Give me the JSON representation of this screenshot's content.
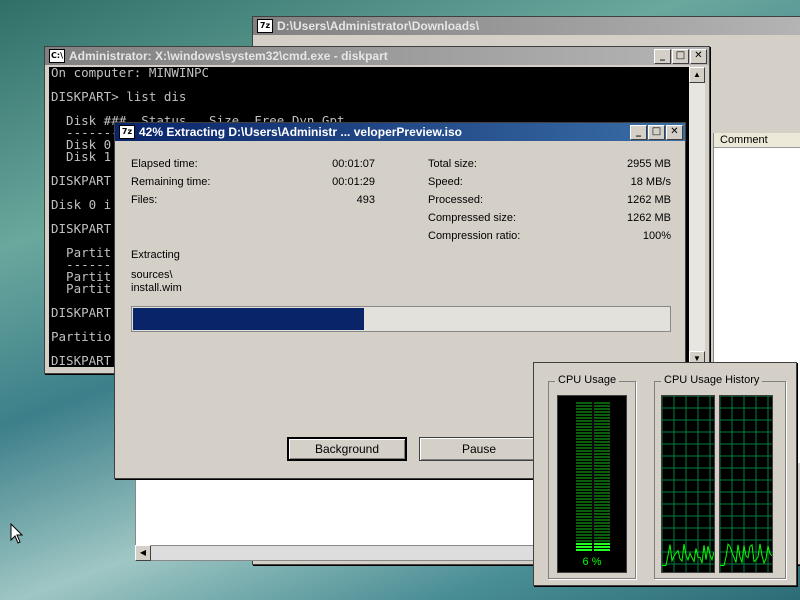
{
  "explorer": {
    "title": "D:\\Users\\Administrator\\Downloads\\",
    "comment_header": "Comment"
  },
  "cmd": {
    "title": "Administrator: X:\\windows\\system32\\cmd.exe - diskpart",
    "lines": [
      "On computer: MINWINPC",
      "",
      "DISKPART> list dis",
      "",
      "  Disk ###  Status   Size  Free Dyn Gpt",
      "  --------",
      "  Disk 0",
      "  Disk 1",
      "",
      "DISKPART",
      "",
      "Disk 0 i",
      "",
      "DISKPART",
      "",
      "  Partit",
      "  ------",
      "  Partit",
      "  Partit",
      "",
      "DISKPART",
      "",
      "Partitio",
      "",
      "DISKPART"
    ]
  },
  "extract": {
    "title": "42% Extracting D:\\Users\\Administr ... veloperPreview.iso",
    "elapsed_label": "Elapsed time:",
    "elapsed_value": "00:01:07",
    "remaining_label": "Remaining time:",
    "remaining_value": "00:01:29",
    "files_label": "Files:",
    "files_value": "493",
    "total_size_label": "Total size:",
    "total_size_value": "2955 MB",
    "speed_label": "Speed:",
    "speed_value": "18 MB/s",
    "processed_label": "Processed:",
    "processed_value": "1262 MB",
    "compressed_label": "Compressed size:",
    "compressed_value": "1262 MB",
    "ratio_label": "Compression ratio:",
    "ratio_value": "100%",
    "status_label": "Extracting",
    "current_path": "sources\\",
    "current_file": "install.wim",
    "progress_fraction": 0.43,
    "background_button": "Background",
    "pause_button": "Pause"
  },
  "taskman": {
    "cpu_usage_label": "CPU Usage",
    "cpu_history_label": "CPU Usage History",
    "cpu_percent": "6 %",
    "cpu_fraction": 0.06
  },
  "colors": {
    "active_title": "#0a246a",
    "progress_fill": "#0a246a",
    "graph_green": "#00ff00"
  }
}
